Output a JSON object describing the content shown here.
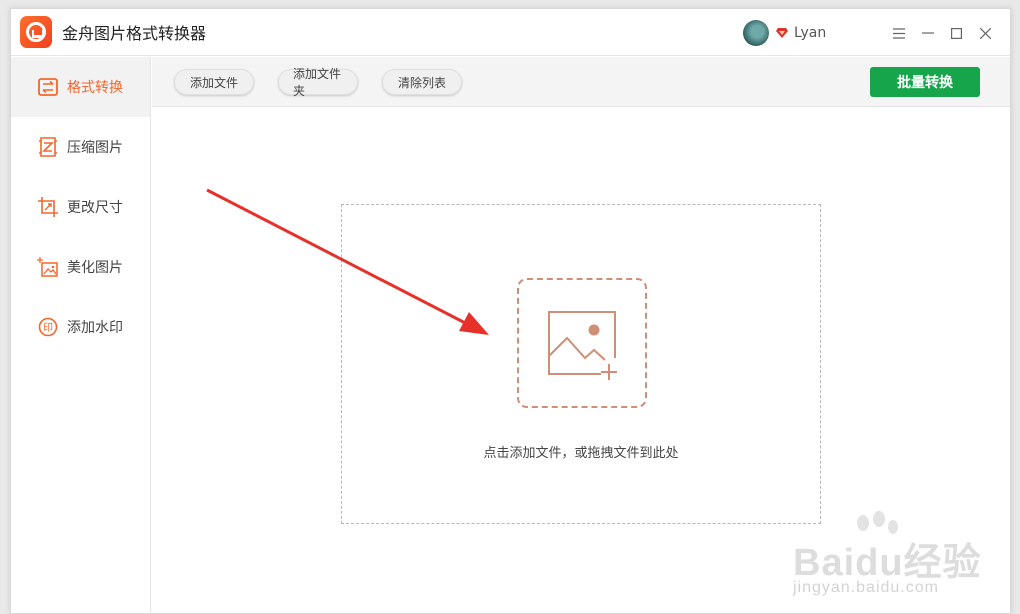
{
  "app": {
    "title": "金舟图片格式转换器"
  },
  "user": {
    "name": "Lyan"
  },
  "sidebar": {
    "items": [
      {
        "label": "格式转换",
        "active": true,
        "icon": "swap-icon"
      },
      {
        "label": "压缩图片",
        "active": false,
        "icon": "compress-icon"
      },
      {
        "label": "更改尺寸",
        "active": false,
        "icon": "resize-icon"
      },
      {
        "label": "美化图片",
        "active": false,
        "icon": "beautify-icon"
      },
      {
        "label": "添加水印",
        "active": false,
        "icon": "watermark-icon"
      }
    ]
  },
  "toolbar": {
    "add_file": "添加文件",
    "add_folder": "添加文件夹",
    "clear_list": "清除列表",
    "batch_convert": "批量转换"
  },
  "dropzone": {
    "hint": "点击添加文件，或拖拽文件到此处"
  },
  "watermark": {
    "brand": "Baidu经验",
    "url": "jingyan.baidu.com"
  },
  "colors": {
    "accent": "#f0682d",
    "primary_green": "#16a54b",
    "arrow_red": "#e8302a"
  }
}
